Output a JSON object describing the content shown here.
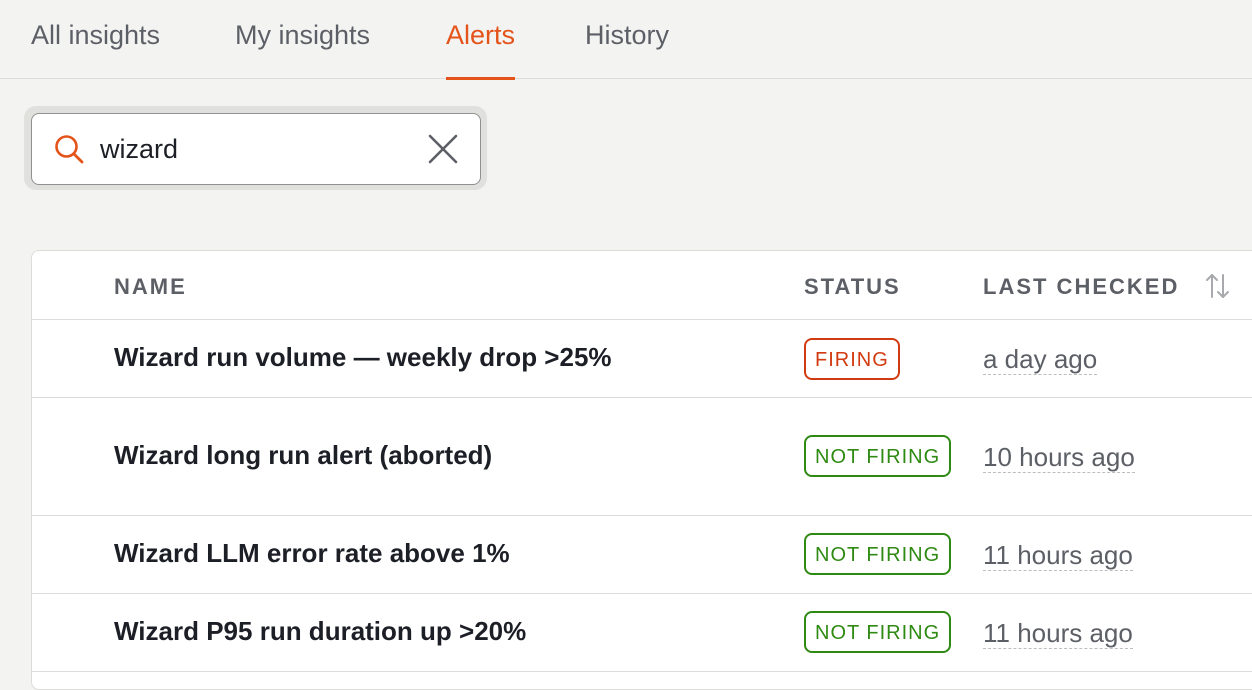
{
  "tabs": [
    {
      "label": "All insights",
      "active": false
    },
    {
      "label": "My insights",
      "active": false
    },
    {
      "label": "Alerts",
      "active": true
    },
    {
      "label": "History",
      "active": false
    }
  ],
  "search": {
    "value": "wizard",
    "icon": "search-icon",
    "clear_icon": "close-icon"
  },
  "table": {
    "columns": {
      "name": "NAME",
      "status": "STATUS",
      "last_checked": "LAST CHECKED"
    },
    "sort_icon": "sort-arrows-icon",
    "rows": [
      {
        "name": "Wizard run volume — weekly drop >25%",
        "status": "FIRING",
        "last_checked": "a day ago"
      },
      {
        "name": "Wizard long run alert (aborted)",
        "status": "NOT FIRING",
        "last_checked": "10 hours ago"
      },
      {
        "name": "Wizard LLM error rate above 1%",
        "status": "NOT FIRING",
        "last_checked": "11 hours ago"
      },
      {
        "name": "Wizard P95 run duration up >20%",
        "status": "NOT FIRING",
        "last_checked": "11 hours ago"
      }
    ]
  },
  "colors": {
    "accent": "#e4531a",
    "firing": "#d23b12",
    "not_firing": "#2f8a14"
  }
}
